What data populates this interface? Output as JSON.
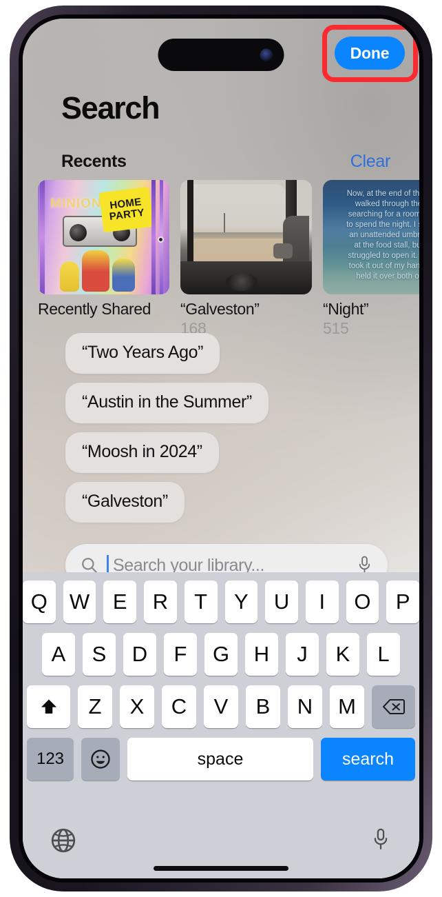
{
  "nav": {
    "done_label": "Done",
    "highlight_color": "#fb2a31",
    "accent_color": "#0a84ff"
  },
  "header": {
    "page_title": "Search"
  },
  "recents": {
    "section_label": "Recents",
    "clear_label": "Clear",
    "cards": [
      {
        "title": "Recently Shared",
        "count": ""
      },
      {
        "title": "“Galveston”",
        "count": "168"
      },
      {
        "title": "“Night”",
        "count": "515"
      }
    ],
    "card_art": {
      "minions_word": "MINIONS",
      "sticker_line1": "HOME",
      "sticker_line2": "PARTY",
      "night_lines": [
        "Now, at the end of the d",
        "walked through the",
        "searching for a room in",
        "to spend the night. I sna",
        "an unattended umbrell",
        "at the food stall, but",
        "struggled to open it. Sa",
        "took it out of my hands",
        "held it over both of"
      ]
    }
  },
  "suggestions": [
    "“Two Years Ago”",
    "“Austin in the Summer”",
    "“Moosh in 2024”",
    "“Galveston”"
  ],
  "search": {
    "placeholder": "Search your library...",
    "value": "",
    "search_icon": "search-icon",
    "mic_icon": "microphone-icon"
  },
  "keyboard": {
    "row1": [
      "Q",
      "W",
      "E",
      "R",
      "T",
      "Y",
      "U",
      "I",
      "O",
      "P"
    ],
    "row2": [
      "A",
      "S",
      "D",
      "F",
      "G",
      "H",
      "J",
      "K",
      "L"
    ],
    "row3": [
      "Z",
      "X",
      "C",
      "V",
      "B",
      "N",
      "M"
    ],
    "shift_icon": "shift-arrow-icon",
    "backspace_icon": "backspace-icon",
    "numeric_label": "123",
    "emoji_label": "☺",
    "space_label": "space",
    "return_label": "search",
    "globe_icon": "globe-icon",
    "dictation_icon": "microphone-icon"
  }
}
